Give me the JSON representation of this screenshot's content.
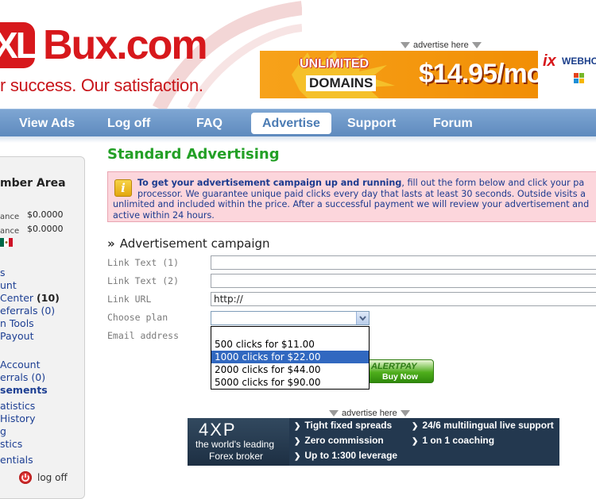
{
  "header": {
    "logo_xl": "XL",
    "logo_bux": "Bux.com",
    "tagline": "r success. Our satisfaction.",
    "advertise_label": "advertise here"
  },
  "top_banner": {
    "line1": "UNLIMITED",
    "line2": "DOMAINS",
    "price": "$14.95/mo",
    "brand": "ix",
    "brand_text": "WEBHO",
    "colors": {
      "background": "#f39200",
      "text": "#ffffff"
    }
  },
  "nav": {
    "items": [
      {
        "label": "View Ads",
        "active": false
      },
      {
        "label": "Log off",
        "active": false
      },
      {
        "label": "FAQ",
        "active": false
      },
      {
        "label": "Advertise",
        "active": true
      },
      {
        "label": "Support",
        "active": false
      },
      {
        "label": "Forum",
        "active": false
      }
    ],
    "colors": {
      "bar": "#6b95c7",
      "active_text": "#4c7cb4"
    }
  },
  "sidebar": {
    "title": "mber Area",
    "balances": [
      {
        "label": "ance",
        "value": "$0.0000"
      },
      {
        "label": "ance",
        "value": "$0.0000"
      }
    ],
    "links": [
      {
        "label": "s",
        "count": "",
        "bold": false
      },
      {
        "label": "unt",
        "count": "",
        "bold": false
      },
      {
        "label": " Center ",
        "count": "(10)",
        "bold": false
      },
      {
        "label": "eferrals ",
        "count": "(0)",
        "bold": false
      },
      {
        "label": "n Tools",
        "count": "",
        "bold": false
      },
      {
        "label": " Payout",
        "count": "",
        "bold": false
      },
      {
        "label": " Account",
        "count": "",
        "bold": false
      },
      {
        "label": "errals ",
        "count": "(0)",
        "bold": false
      },
      {
        "label": "sements",
        "count": "",
        "bold": true
      },
      {
        "label": "atistics",
        "count": "",
        "bold": false
      },
      {
        "label": " History",
        "count": "",
        "bold": false
      },
      {
        "label": "g",
        "count": "",
        "bold": false
      },
      {
        "label": "stics",
        "count": "",
        "bold": false
      },
      {
        "label": "entials",
        "count": "",
        "bold": false
      }
    ],
    "logoff_label": "log off"
  },
  "main": {
    "title": "Standard Advertising",
    "info": {
      "bold": "To get your advertisement campaign up and running",
      "line1_rest": ", fill out the form below and click your pa",
      "line2": "processor. We guarantee unique paid clicks every day that lasts at least 30 seconds. Outside visits a",
      "line3": "unlimited and included within the price. After a successful payment we will review your advertisement and",
      "line4": "active within 24 hours."
    },
    "section_title": "Advertisement campaign",
    "form": {
      "link_text_1_label": "Link Text (1)",
      "link_text_1_value": "",
      "link_text_2_label": "Link Text (2)",
      "link_text_2_value": "",
      "link_url_label": "Link URL",
      "link_url_value": "http://",
      "choose_plan_label": "Choose plan",
      "choose_plan_value": "",
      "email_label": "Email address",
      "plan_options": [
        "",
        "500 clicks for $11.00",
        "1000 clicks for $22.00",
        "2000 clicks for $44.00",
        "5000 clicks for $90.00"
      ],
      "highlighted_option": "1000 clicks for $22.00"
    },
    "alertpay": {
      "logo": "ALERTPAY",
      "button": "Buy Now"
    }
  },
  "bottom_banner": {
    "advertise_label": "advertise here",
    "logo": "4XP",
    "tagline1": "the world's leading",
    "tagline2": "Forex broker",
    "features": [
      "Tight fixed spreads",
      "Zero commission",
      "Up to 1:300 leverage",
      "24/6 multilingual live support",
      "1 on 1 coaching"
    ]
  }
}
